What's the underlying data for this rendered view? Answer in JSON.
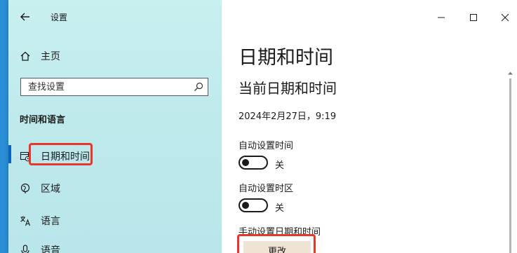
{
  "window": {
    "app_title": "设置"
  },
  "left": {
    "back_icon": "arrow-left-icon",
    "home": {
      "icon": "home-icon",
      "label": "主页"
    },
    "search": {
      "placeholder": "查找设置",
      "icon": "search-icon"
    },
    "section_heading": "时间和语言",
    "nav": [
      {
        "icon": "calendar-clock-icon",
        "label": "日期和时间",
        "selected": true
      },
      {
        "icon": "globe-region-icon",
        "label": "区域",
        "selected": false
      },
      {
        "icon": "language-icon",
        "label": "语言",
        "selected": false
      },
      {
        "icon": "microphone-icon",
        "label": "语音",
        "selected": false
      }
    ]
  },
  "right": {
    "window_controls": {
      "minimize_icon": "minimize-icon",
      "maximize_icon": "maximize-icon",
      "close_icon": "close-icon"
    },
    "page_title": "日期和时间",
    "subheading": "当前日期和时间",
    "current_datetime": "2024年2月27日，9:19",
    "auto_time": {
      "label": "自动设置时间",
      "state": "关"
    },
    "auto_timezone": {
      "label": "自动设置时区",
      "state": "关"
    },
    "manual": {
      "label": "手动设置日期和时间",
      "button": "更改"
    }
  },
  "colors": {
    "left_pane": "#c9efef",
    "accent": "#0a64c8",
    "highlight": "#e8362a",
    "button_bg": "#efe3d4"
  }
}
